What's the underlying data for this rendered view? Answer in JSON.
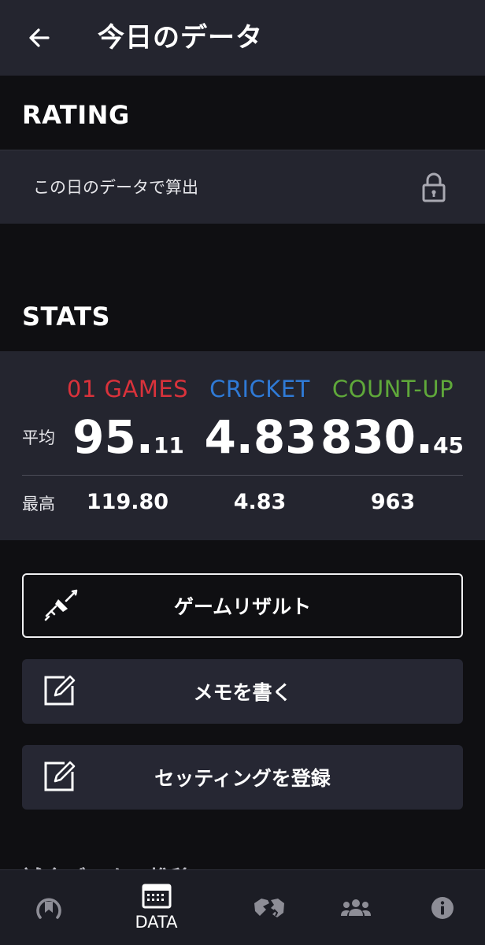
{
  "header": {
    "title": "今日のデータ"
  },
  "rating": {
    "section_title": "RATING",
    "label": "この日のデータで算出"
  },
  "stats": {
    "section_title": "STATS",
    "columns": [
      {
        "name": "01 GAMES",
        "color": "#d9323b",
        "avg_int": "95.",
        "avg_dec": "11",
        "max": "119.80"
      },
      {
        "name": "CRICKET",
        "color": "#2f7ad6",
        "avg_int": "4.83",
        "avg_dec": "",
        "max": "4.83"
      },
      {
        "name": "COUNT-UP",
        "color": "#5fa83a",
        "avg_int": "830.",
        "avg_dec": "45",
        "max": "963"
      }
    ],
    "avg_label": "平均",
    "max_label": "最高"
  },
  "buttons": {
    "game_result": "ゲームリザルト",
    "write_memo": "メモを書く",
    "register_setting": "セッティングを登録"
  },
  "clipped_text": "試合データの推移",
  "bottom_nav": {
    "items": [
      {
        "icon": "bookmark-ring-icon",
        "label": ""
      },
      {
        "icon": "calendar-icon",
        "label": "DATA"
      },
      {
        "icon": "handshake-icon",
        "label": ""
      },
      {
        "icon": "group-icon",
        "label": ""
      },
      {
        "icon": "info-icon",
        "label": ""
      }
    ]
  }
}
